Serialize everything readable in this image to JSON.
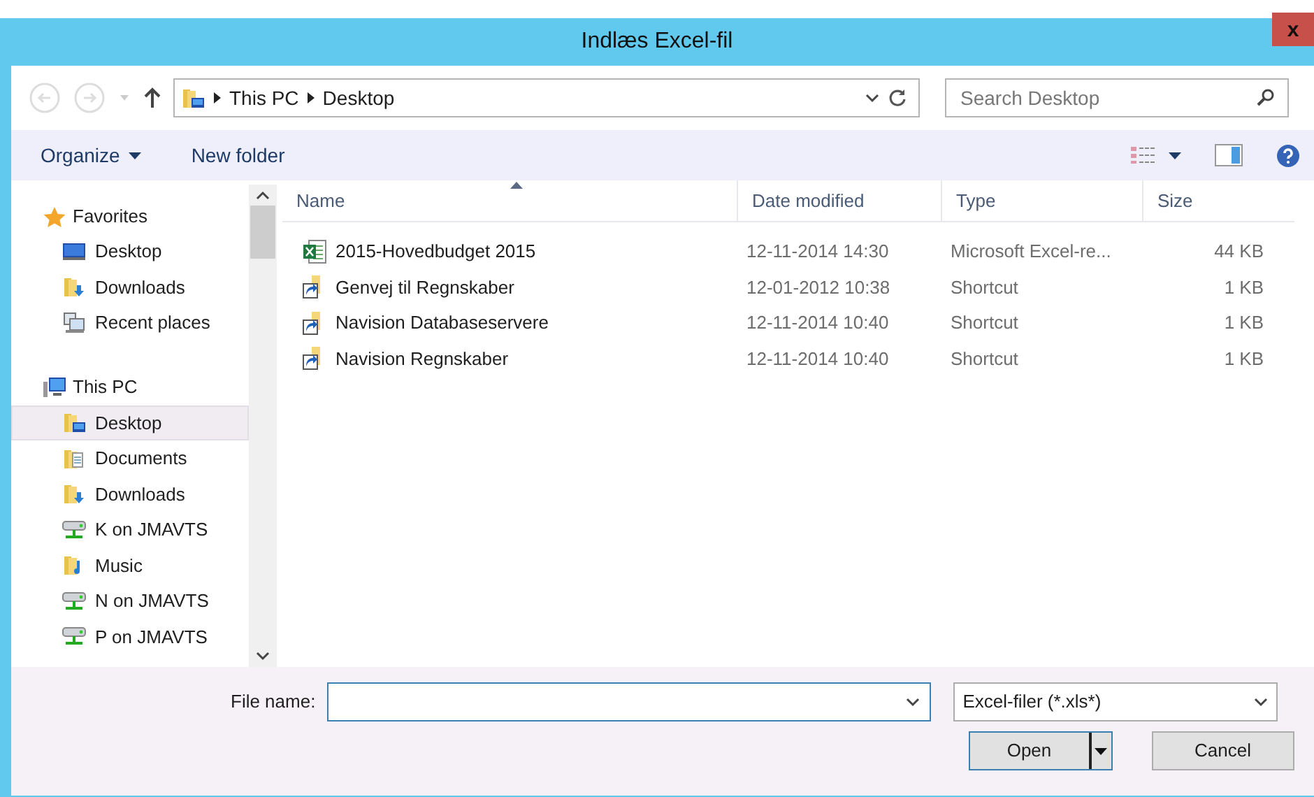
{
  "window": {
    "title": "Indlæs Excel-fil",
    "close": "x"
  },
  "address": {
    "crumbs": [
      "This PC",
      "Desktop"
    ]
  },
  "search": {
    "placeholder": "Search Desktop"
  },
  "toolbar": {
    "items": [
      {
        "label": "Organize",
        "dropdown": true
      },
      {
        "label": "New folder",
        "dropdown": false
      }
    ]
  },
  "nav": [
    {
      "label": "Favorites",
      "kind": "star",
      "children": [
        {
          "label": "Desktop",
          "kind": "monitor",
          "selected": false
        },
        {
          "label": "Downloads",
          "kind": "download",
          "selected": false
        },
        {
          "label": "Recent places",
          "kind": "recent",
          "selected": false
        }
      ]
    },
    {
      "label": "This PC",
      "kind": "pc",
      "children": [
        {
          "label": "Desktop",
          "kind": "desktop",
          "selected": true
        },
        {
          "label": "Documents",
          "kind": "documents",
          "selected": false
        },
        {
          "label": "Downloads",
          "kind": "download",
          "selected": false
        },
        {
          "label": "K on JMAVTS",
          "kind": "drive",
          "selected": false
        },
        {
          "label": "Music",
          "kind": "music",
          "selected": false
        },
        {
          "label": "N on JMAVTS",
          "kind": "drive",
          "selected": false
        },
        {
          "label": "P on JMAVTS",
          "kind": "drive",
          "selected": false
        }
      ]
    }
  ],
  "table": {
    "columns": [
      {
        "label": "Name",
        "sorted": true
      },
      {
        "label": "Date modified",
        "sorted": false
      },
      {
        "label": "Type",
        "sorted": false
      },
      {
        "label": "Size",
        "sorted": false
      }
    ],
    "rows": [
      {
        "kind": "excel",
        "name": "2015-Hovedbudget 2015",
        "date": "12-11-2014 14:30",
        "type": "Microsoft Excel-re...",
        "size": "44 KB"
      },
      {
        "kind": "shortcut",
        "name": "Genvej til Regnskaber",
        "date": "12-01-2012 10:38",
        "type": "Shortcut",
        "size": "1 KB"
      },
      {
        "kind": "shortcut",
        "name": "Navision Databaseservere",
        "date": "12-11-2014 10:40",
        "type": "Shortcut",
        "size": "1 KB"
      },
      {
        "kind": "shortcut",
        "name": "Navision Regnskaber",
        "date": "12-11-2014 10:40",
        "type": "Shortcut",
        "size": "1 KB"
      }
    ]
  },
  "file_name": {
    "label": "File name:"
  },
  "file_type": {
    "value": "Excel-filer (*.xls*)"
  },
  "buttons": [
    {
      "label": "Open",
      "kind": "split"
    },
    {
      "label": "Cancel",
      "kind": "plain"
    }
  ]
}
